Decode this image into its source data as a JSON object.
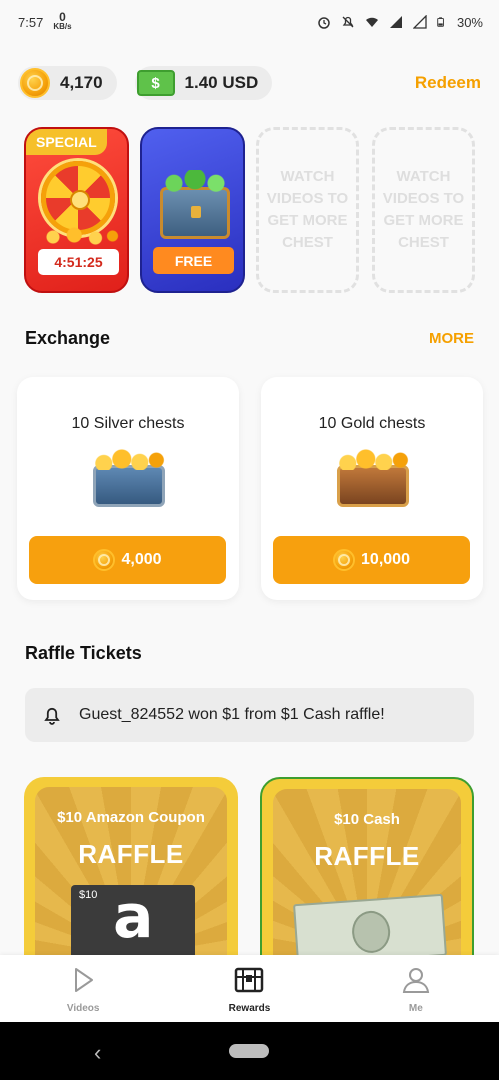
{
  "status_bar": {
    "time": "7:57",
    "net_speed_value": "0",
    "net_speed_unit": "KB/s",
    "battery": "30%"
  },
  "balance": {
    "coins": "4,170",
    "cash": "1.40 USD",
    "redeem_label": "Redeem"
  },
  "chests": {
    "special_tag": "SPECIAL",
    "special_timer": "4:51:25",
    "free_label": "FREE",
    "empty_slot_text": "WATCH VIDEOS TO GET MORE CHEST"
  },
  "exchange": {
    "title": "Exchange",
    "more_label": "MORE",
    "items": [
      {
        "title": "10 Silver chests",
        "price": "4,000"
      },
      {
        "title": "10 Gold chests",
        "price": "10,000"
      }
    ]
  },
  "raffle": {
    "title": "Raffle Tickets",
    "ticker": "Guest_824552 won $1 from $1 Cash raffle!",
    "cards": [
      {
        "subtitle": "$10 Amazon Coupon",
        "label": "RAFFLE",
        "card_amount": "$10",
        "card_letter": "a"
      },
      {
        "subtitle": "$10 Cash",
        "label": "RAFFLE"
      }
    ]
  },
  "bottom_nav": {
    "items": [
      {
        "label": "Videos",
        "icon": "play-icon"
      },
      {
        "label": "Rewards",
        "icon": "chest-icon"
      },
      {
        "label": "Me",
        "icon": "person-icon"
      }
    ]
  },
  "colors": {
    "accent": "#f5a000",
    "button_orange": "#f7a00e",
    "special_red": "#e0201a",
    "free_blue": "#3a43d8",
    "raffle_gold": "#f4cc3a"
  }
}
